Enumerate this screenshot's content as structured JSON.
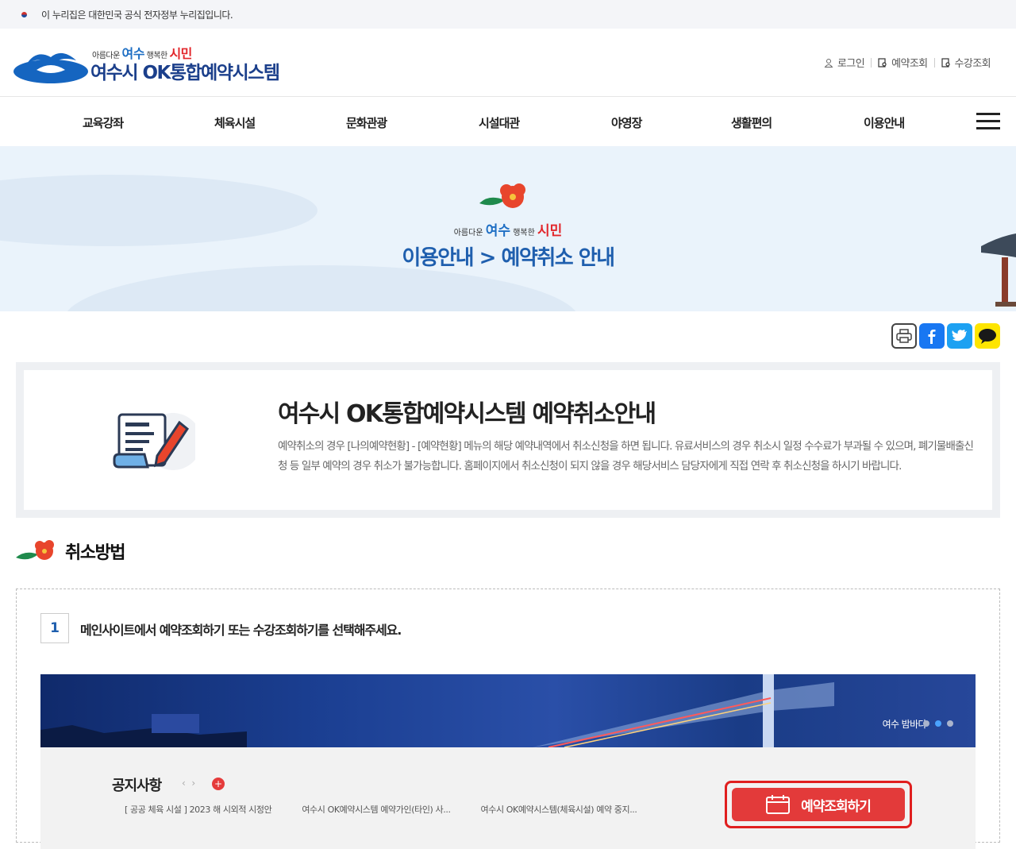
{
  "gov_banner": {
    "text": "이 누리집은 대한민국 공식 전자정부 누리집입니다."
  },
  "header": {
    "slogan": {
      "prefix": "아름다운",
      "city": "여수",
      "mid": "행복한",
      "citizen": "시민"
    },
    "site_name": "여수시 OK통합예약시스템",
    "utils": [
      {
        "label": "로그인",
        "icon": "user-icon"
      },
      {
        "label": "예약조회",
        "icon": "search-doc-icon"
      },
      {
        "label": "수강조회",
        "icon": "search-doc-icon"
      }
    ]
  },
  "gnb": {
    "items": [
      "교육강좌",
      "체육시설",
      "문화관광",
      "시설대관",
      "야영장",
      "생활편의",
      "이용안내"
    ]
  },
  "visual": {
    "slogan": {
      "prefix": "아름다운",
      "city": "여수",
      "mid": "행복한",
      "citizen": "시민"
    },
    "title": "이용안내 > 예약취소 안내"
  },
  "share": [
    "print-icon",
    "facebook-icon",
    "twitter-icon",
    "kakaotalk-icon"
  ],
  "intro": {
    "title": "여수시 OK통합예약시스템 예약취소안내",
    "body": "예약취소의 경우 [나의예약현황] - [예약현황] 메뉴의 해당 예약내역에서 취소신청을 하면 됩니다. 유료서비스의 경우 취소시 일정 수수료가 부과될 수 있으며, 폐기물배출신청 등 일부 예약의 경우 취소가 불가능합니다. 홈페이지에서 취소신청이 되지 않을 경우 해당서비스 담당자에게 직접 연락 후 취소신청을 하시기 바랍니다."
  },
  "section": {
    "title": "취소방법"
  },
  "steps": [
    {
      "num": "1",
      "text": "메인사이트에서 예약조회하기 또는 수강조회하기를 선택해주세요."
    }
  ],
  "screenshot": {
    "banner_text": "여수 밤바다",
    "notice_title": "공지사항",
    "notice_items": [
      "[ 공공 체육 시설 ] 2023 해 시외적 시정안",
      "여수시 OK예약시스템 예약가인(타인) 사...",
      "여수시 OK예약시스템(체육시설) 예약 중지..."
    ],
    "reserve_button": "예약조회하기"
  },
  "colors": {
    "brand_blue": "#1f5fae",
    "accent_red": "#e33a3a",
    "visual_bg": "#eaf3fb"
  }
}
